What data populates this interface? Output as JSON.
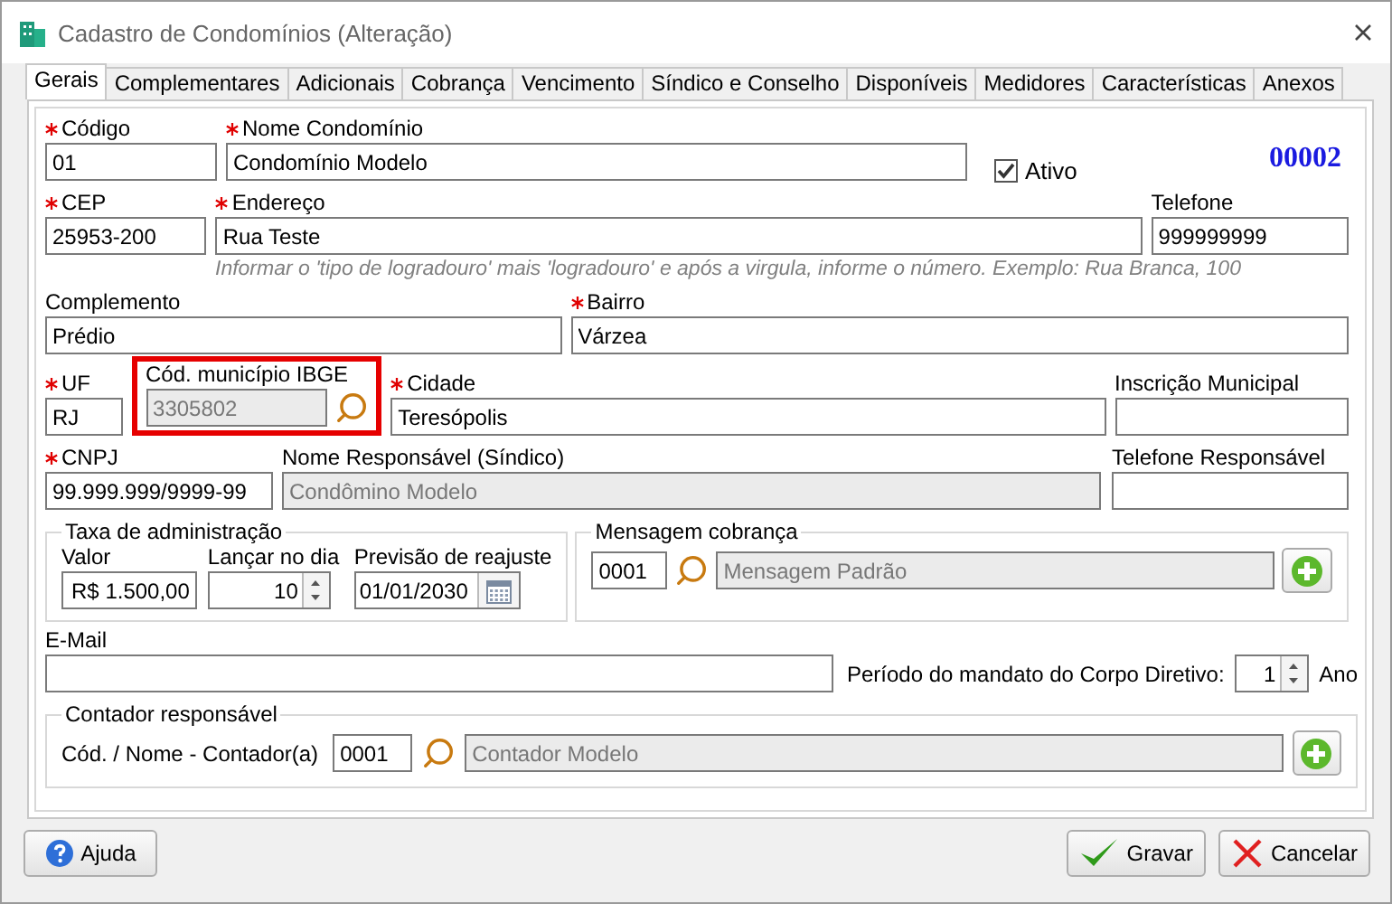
{
  "window": {
    "title": "Cadastro de Condomínios (Alteração)"
  },
  "tabs": [
    {
      "label": "Gerais",
      "selected": true
    },
    {
      "label": "Complementares",
      "selected": false
    },
    {
      "label": "Adicionais",
      "selected": false
    },
    {
      "label": "Cobrança",
      "selected": false
    },
    {
      "label": "Vencimento",
      "selected": false
    },
    {
      "label": "Síndico e Conselho",
      "selected": false
    },
    {
      "label": "Disponíveis",
      "selected": false
    },
    {
      "label": "Medidores",
      "selected": false
    },
    {
      "label": "Características",
      "selected": false
    },
    {
      "label": "Anexos",
      "selected": false
    }
  ],
  "rows": [
    {
      "fields": [
        {
          "kind": "text",
          "label": "Código",
          "required": true,
          "value": "01",
          "disabled": false
        },
        {
          "kind": "text",
          "label": "Nome Condomínio",
          "required": true,
          "value": "Condomínio Modelo",
          "disabled": false
        },
        {
          "kind": "check",
          "label": "Ativo",
          "checked": true
        },
        {
          "kind": "code",
          "value": "00002"
        }
      ]
    },
    {
      "fields": [
        {
          "kind": "text",
          "label": "CEP",
          "required": true,
          "value": "25953-200",
          "disabled": false
        },
        {
          "kind": "text",
          "label": "Endereço",
          "required": true,
          "value": "Rua Teste",
          "disabled": false
        },
        {
          "kind": "text",
          "label": "Telefone",
          "required": false,
          "value": "999999999",
          "disabled": false
        }
      ],
      "hint": "Informar o 'tipo de logradouro' mais 'logradouro' e após a virgula, informe o número. Exemplo: Rua Branca, 100"
    },
    {
      "fields": [
        {
          "kind": "text",
          "label": "Complemento",
          "required": false,
          "value": "Prédio",
          "disabled": false
        },
        {
          "kind": "text",
          "label": "Bairro",
          "required": true,
          "value": "Várzea",
          "disabled": false
        }
      ]
    },
    {
      "fields": [
        {
          "kind": "text",
          "label": "UF",
          "required": true,
          "value": "RJ",
          "disabled": false
        },
        {
          "kind": "lookup",
          "label": "Cód. município IBGE",
          "required": false,
          "value": "3305802",
          "disabled": true,
          "highlighted": true
        },
        {
          "kind": "text",
          "label": "Cidade",
          "required": true,
          "value": "Teresópolis",
          "disabled": false
        },
        {
          "kind": "text",
          "label": "Inscrição Municipal",
          "required": false,
          "disabled": false
        }
      ]
    },
    {
      "fields": [
        {
          "kind": "text",
          "label": "CNPJ",
          "required": true,
          "value": "99.999.999/9999-99",
          "disabled": false
        },
        {
          "kind": "text",
          "label": "Nome Responsável (Síndico)",
          "required": false,
          "value": "Condômino Modelo",
          "disabled": true
        },
        {
          "kind": "text",
          "label": "Telefone Responsável",
          "required": false,
          "disabled": false
        }
      ]
    }
  ],
  "admin_fee": {
    "title": "Taxa de administração",
    "valor": {
      "label": "Valor",
      "value": "R$ 1.500,00"
    },
    "dia": {
      "label": "Lançar no dia",
      "value": "10"
    },
    "reajuste": {
      "label": "Previsão de reajuste",
      "value": "01/01/2030"
    }
  },
  "billing_message": {
    "title": "Mensagem cobrança",
    "code": "0001",
    "name": "Mensagem Padrão"
  },
  "email": {
    "label": "E-Mail"
  },
  "mandate": {
    "label": "Período do mandato do Corpo Diretivo:",
    "value": "1",
    "unit": "Ano"
  },
  "accountant": {
    "title": "Contador responsável",
    "label": "Cód. / Nome - Contador(a)",
    "code": "0001",
    "name": "Contador Modelo"
  },
  "buttons": [
    {
      "kind": "help",
      "label": "Ajuda"
    },
    {
      "kind": "save",
      "label": "Gravar"
    },
    {
      "kind": "cancel",
      "label": "Cancelar"
    }
  ]
}
